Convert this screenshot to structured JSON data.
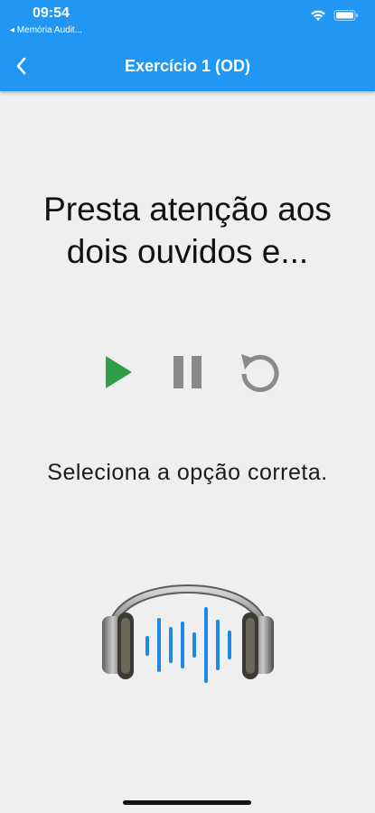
{
  "status_bar": {
    "time": "09:54",
    "back_app": "◂ Memória Audit..."
  },
  "header": {
    "title": "Exercício 1 (OD)",
    "back_icon": "chevron-left-icon"
  },
  "main": {
    "instruction": "Presta atenção aos dois ouvidos e...",
    "subtext": "Seleciona a opção correta.",
    "controls": {
      "play_icon": "play-icon",
      "pause_icon": "pause-icon",
      "replay_icon": "replay-icon"
    },
    "illustration": "headphones-soundwave-icon"
  },
  "colors": {
    "appbar": "#2196f3",
    "background": "#efefef",
    "play": "#2e9e48",
    "controls_gray": "#8a8a8a",
    "soundwave": "#1e88e5"
  }
}
